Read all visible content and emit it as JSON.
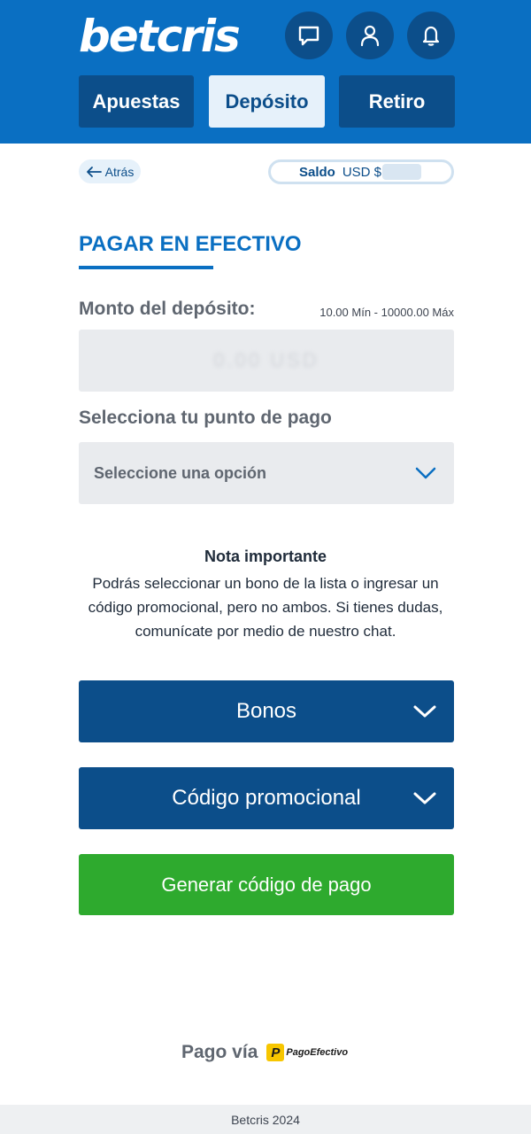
{
  "header": {
    "logo": "betcris",
    "icons": {
      "chat": "chat-icon",
      "user": "user-icon",
      "bell": "bell-icon"
    },
    "tabs": [
      {
        "label": "Apuestas",
        "active": false
      },
      {
        "label": "Depósito",
        "active": true
      },
      {
        "label": "Retiro",
        "active": false
      }
    ]
  },
  "nav": {
    "back_label": "Atrás",
    "balance_label": "Saldo",
    "balance_currency": "USD $"
  },
  "form": {
    "title": "PAGAR EN EFECTIVO",
    "amount_label": "Monto del depósito:",
    "amount_range": "10.00 Mín - 10000.00 Máx",
    "amount_placeholder": "0.00 USD",
    "point_label": "Selecciona tu punto de pago",
    "point_select": "Seleccione una opción"
  },
  "note": {
    "title": "Nota importante",
    "body": "Podrás seleccionar un bono de la lista o ingresar un código promocional, pero no ambos. Si tienes dudas, comunícate por medio de nuestro chat."
  },
  "accordions": {
    "bonus": "Bonos",
    "promo": "Código promocional"
  },
  "actions": {
    "generate": "Generar código de pago"
  },
  "payment_via": {
    "label": "Pago vía",
    "provider": "PagoEfectivo"
  },
  "footer": {
    "text": "Betcris 2024"
  },
  "colors": {
    "brand_blue": "#0a6fc2",
    "dark_blue": "#0c4e8a",
    "green": "#2eaa2e"
  }
}
